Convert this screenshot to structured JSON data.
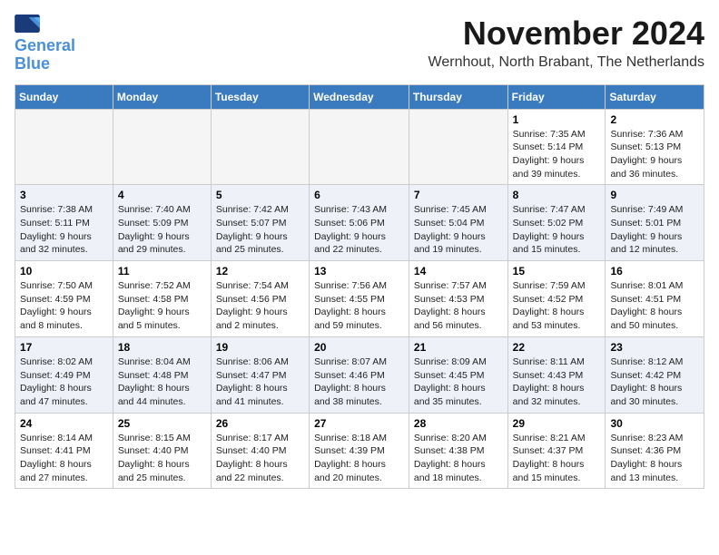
{
  "logo": {
    "line1": "General",
    "line2": "Blue"
  },
  "title": "November 2024",
  "subtitle": "Wernhout, North Brabant, The Netherlands",
  "days_of_week": [
    "Sunday",
    "Monday",
    "Tuesday",
    "Wednesday",
    "Thursday",
    "Friday",
    "Saturday"
  ],
  "weeks": [
    [
      {
        "day": "",
        "info": ""
      },
      {
        "day": "",
        "info": ""
      },
      {
        "day": "",
        "info": ""
      },
      {
        "day": "",
        "info": ""
      },
      {
        "day": "",
        "info": ""
      },
      {
        "day": "1",
        "info": "Sunrise: 7:35 AM\nSunset: 5:14 PM\nDaylight: 9 hours\nand 39 minutes."
      },
      {
        "day": "2",
        "info": "Sunrise: 7:36 AM\nSunset: 5:13 PM\nDaylight: 9 hours\nand 36 minutes."
      }
    ],
    [
      {
        "day": "3",
        "info": "Sunrise: 7:38 AM\nSunset: 5:11 PM\nDaylight: 9 hours\nand 32 minutes."
      },
      {
        "day": "4",
        "info": "Sunrise: 7:40 AM\nSunset: 5:09 PM\nDaylight: 9 hours\nand 29 minutes."
      },
      {
        "day": "5",
        "info": "Sunrise: 7:42 AM\nSunset: 5:07 PM\nDaylight: 9 hours\nand 25 minutes."
      },
      {
        "day": "6",
        "info": "Sunrise: 7:43 AM\nSunset: 5:06 PM\nDaylight: 9 hours\nand 22 minutes."
      },
      {
        "day": "7",
        "info": "Sunrise: 7:45 AM\nSunset: 5:04 PM\nDaylight: 9 hours\nand 19 minutes."
      },
      {
        "day": "8",
        "info": "Sunrise: 7:47 AM\nSunset: 5:02 PM\nDaylight: 9 hours\nand 15 minutes."
      },
      {
        "day": "9",
        "info": "Sunrise: 7:49 AM\nSunset: 5:01 PM\nDaylight: 9 hours\nand 12 minutes."
      }
    ],
    [
      {
        "day": "10",
        "info": "Sunrise: 7:50 AM\nSunset: 4:59 PM\nDaylight: 9 hours\nand 8 minutes."
      },
      {
        "day": "11",
        "info": "Sunrise: 7:52 AM\nSunset: 4:58 PM\nDaylight: 9 hours\nand 5 minutes."
      },
      {
        "day": "12",
        "info": "Sunrise: 7:54 AM\nSunset: 4:56 PM\nDaylight: 9 hours\nand 2 minutes."
      },
      {
        "day": "13",
        "info": "Sunrise: 7:56 AM\nSunset: 4:55 PM\nDaylight: 8 hours\nand 59 minutes."
      },
      {
        "day": "14",
        "info": "Sunrise: 7:57 AM\nSunset: 4:53 PM\nDaylight: 8 hours\nand 56 minutes."
      },
      {
        "day": "15",
        "info": "Sunrise: 7:59 AM\nSunset: 4:52 PM\nDaylight: 8 hours\nand 53 minutes."
      },
      {
        "day": "16",
        "info": "Sunrise: 8:01 AM\nSunset: 4:51 PM\nDaylight: 8 hours\nand 50 minutes."
      }
    ],
    [
      {
        "day": "17",
        "info": "Sunrise: 8:02 AM\nSunset: 4:49 PM\nDaylight: 8 hours\nand 47 minutes."
      },
      {
        "day": "18",
        "info": "Sunrise: 8:04 AM\nSunset: 4:48 PM\nDaylight: 8 hours\nand 44 minutes."
      },
      {
        "day": "19",
        "info": "Sunrise: 8:06 AM\nSunset: 4:47 PM\nDaylight: 8 hours\nand 41 minutes."
      },
      {
        "day": "20",
        "info": "Sunrise: 8:07 AM\nSunset: 4:46 PM\nDaylight: 8 hours\nand 38 minutes."
      },
      {
        "day": "21",
        "info": "Sunrise: 8:09 AM\nSunset: 4:45 PM\nDaylight: 8 hours\nand 35 minutes."
      },
      {
        "day": "22",
        "info": "Sunrise: 8:11 AM\nSunset: 4:43 PM\nDaylight: 8 hours\nand 32 minutes."
      },
      {
        "day": "23",
        "info": "Sunrise: 8:12 AM\nSunset: 4:42 PM\nDaylight: 8 hours\nand 30 minutes."
      }
    ],
    [
      {
        "day": "24",
        "info": "Sunrise: 8:14 AM\nSunset: 4:41 PM\nDaylight: 8 hours\nand 27 minutes."
      },
      {
        "day": "25",
        "info": "Sunrise: 8:15 AM\nSunset: 4:40 PM\nDaylight: 8 hours\nand 25 minutes."
      },
      {
        "day": "26",
        "info": "Sunrise: 8:17 AM\nSunset: 4:40 PM\nDaylight: 8 hours\nand 22 minutes."
      },
      {
        "day": "27",
        "info": "Sunrise: 8:18 AM\nSunset: 4:39 PM\nDaylight: 8 hours\nand 20 minutes."
      },
      {
        "day": "28",
        "info": "Sunrise: 8:20 AM\nSunset: 4:38 PM\nDaylight: 8 hours\nand 18 minutes."
      },
      {
        "day": "29",
        "info": "Sunrise: 8:21 AM\nSunset: 4:37 PM\nDaylight: 8 hours\nand 15 minutes."
      },
      {
        "day": "30",
        "info": "Sunrise: 8:23 AM\nSunset: 4:36 PM\nDaylight: 8 hours\nand 13 minutes."
      }
    ]
  ]
}
